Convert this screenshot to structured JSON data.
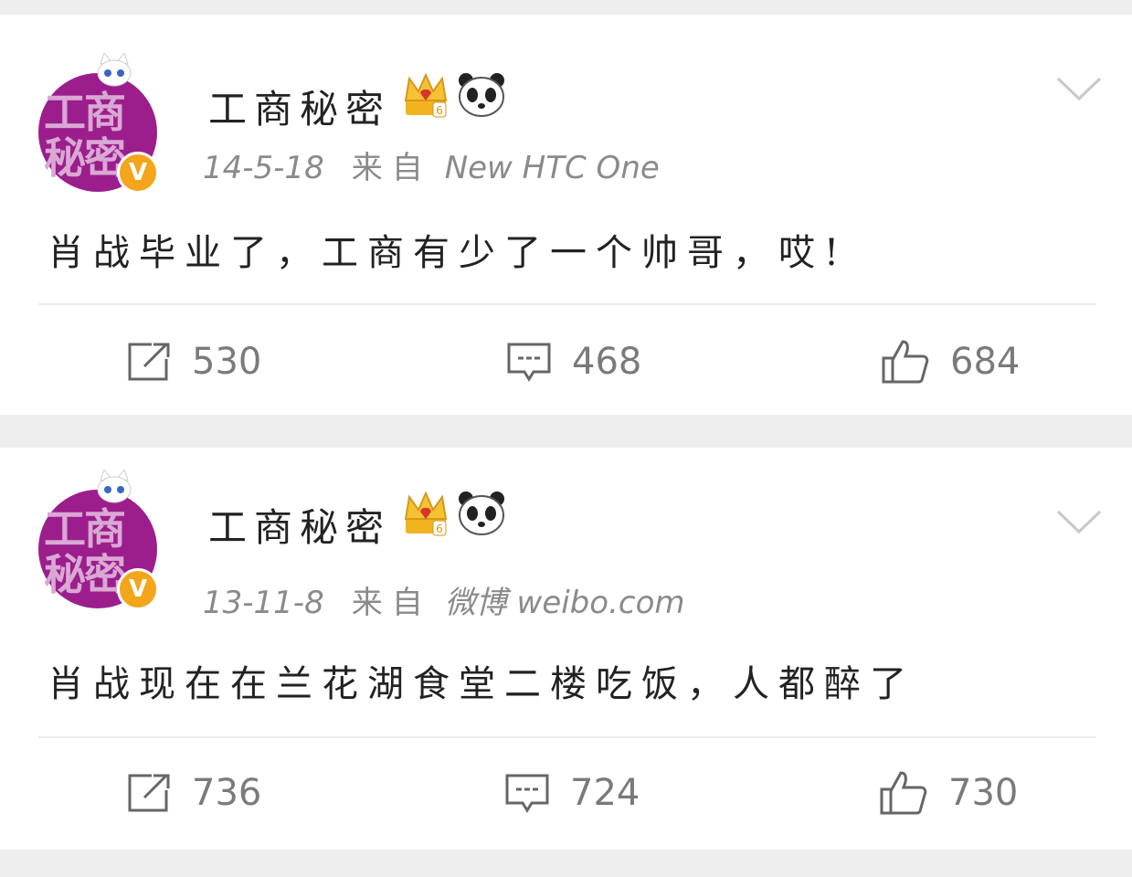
{
  "posts": [
    {
      "avatar_text": "工商\n秘密",
      "username": "工商秘密",
      "date": "14-5-18",
      "source_label": "来自",
      "source": "New HTC One",
      "text": "肖战毕业了，工商有少了一个帅哥，哎!",
      "reposts": "530",
      "comments": "468",
      "likes": "684"
    },
    {
      "avatar_text": "工商\n秘密",
      "username": "工商秘密",
      "date": "13-11-8",
      "source_label": "来自",
      "source": "微博 weibo.com",
      "text": "肖战现在在兰花湖食堂二楼吃饭，人都醉了",
      "reposts": "736",
      "comments": "724",
      "likes": "730"
    }
  ],
  "colors": {
    "avatar_bg": "#9b1e8c",
    "verified_badge": "#f3a51b",
    "meta_text": "#8a8a8a",
    "action_text": "#7a7a7a",
    "page_bg": "#eeeeee"
  },
  "icons": {
    "pendant": "cat-pendant-icon",
    "verified": "verified-v-icon",
    "crown": "vip-crown-icon",
    "panda": "panda-icon",
    "menu": "chevron-down-icon",
    "repost": "repost-icon",
    "comment": "comment-icon",
    "like": "thumbs-up-icon"
  }
}
